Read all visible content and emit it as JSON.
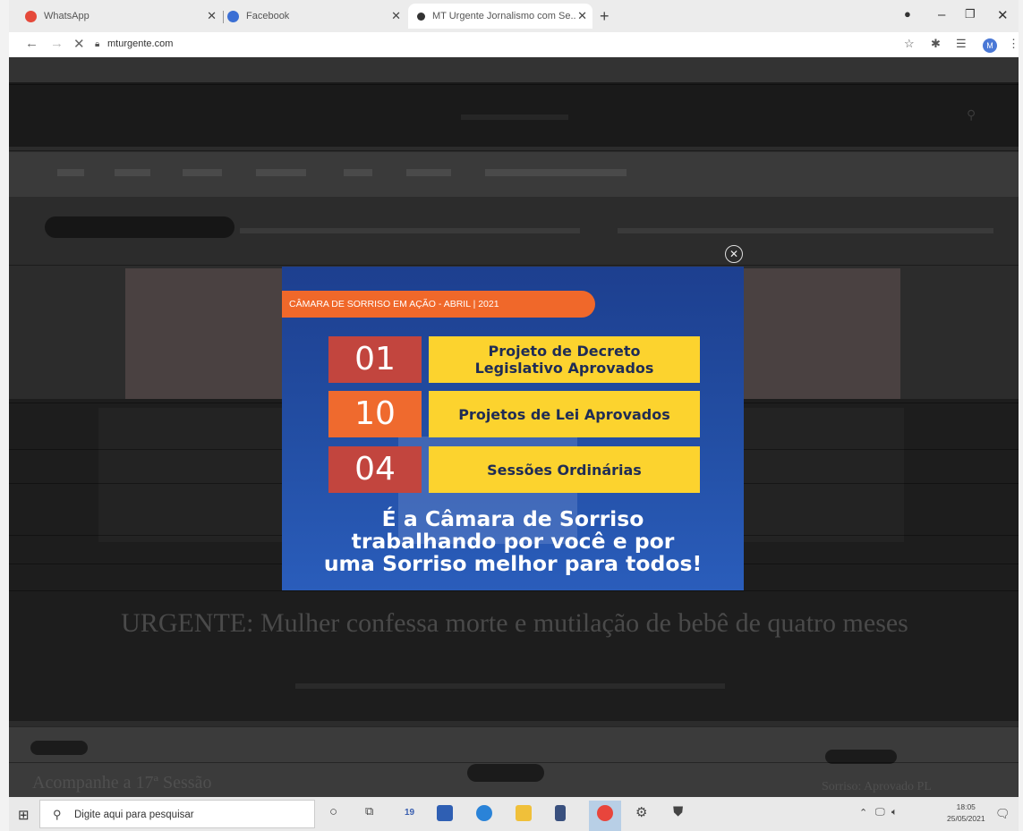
{
  "browser": {
    "tabs": [
      {
        "title": "WhatsApp",
        "color": "#e5493a"
      },
      {
        "title": "Facebook",
        "color": "#3b6fd4"
      },
      {
        "title": "MT Urgente Jornalismo com Se...",
        "color": "#333333"
      }
    ],
    "new_tab_symbol": "+",
    "url": "mturgente.com",
    "avatar_letter": "M"
  },
  "website": {
    "headline": "URGENTE: Mulher confessa morte e mutilação de bebê de quatro meses",
    "bottom_left_title": "Acompanhe a 17ª Sessão",
    "bottom_right_title": "Sorriso: Aprovado PL"
  },
  "popup": {
    "title": "CÂMARA DE SORRISO EM AÇÃO - ABRIL | 2021",
    "stats": [
      {
        "number": "01",
        "label": "Projeto de Decreto Legislativo Aprovados",
        "number_bg": "#c2453e"
      },
      {
        "number": "10",
        "label": "Projetos de Lei Aprovados",
        "number_bg": "#ef6a2e"
      },
      {
        "number": "04",
        "label": "Sessões Ordinárias",
        "number_bg": "#c2453e"
      }
    ],
    "slogan_line1": "É a Câmara de Sorriso",
    "slogan_line2": "trabalhando por você e por",
    "slogan_line3": "uma Sorriso melhor para todos!",
    "accent_color": "#f0682a",
    "label_color": "#fcd32e"
  },
  "taskbar": {
    "search_placeholder": "Digite aqui para pesquisar",
    "calendar_badge": "19",
    "time": "18:05",
    "date": "25/05/2021"
  }
}
